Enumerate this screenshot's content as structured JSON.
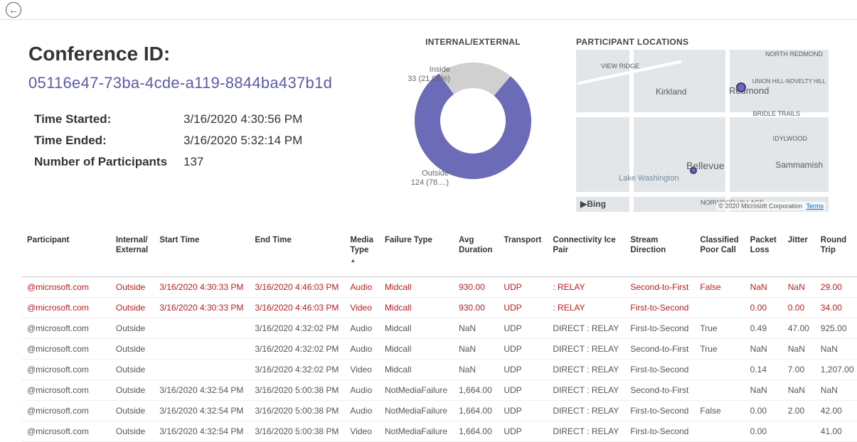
{
  "header": {
    "conference_label": "Conference ID:",
    "conference_id": "05116e47-73ba-4cde-a119-8844ba437b1d",
    "fields": {
      "time_started_label": "Time Started:",
      "time_started_value": "3/16/2020 4:30:56 PM",
      "time_ended_label": "Time Ended:",
      "time_ended_value": "3/16/2020 5:32:14 PM",
      "participants_label": "Number of Participants",
      "participants_value": "137"
    }
  },
  "donut": {
    "title": "INTERNAL/EXTERNAL",
    "inside_label": "Inside",
    "inside_count": "33 (21.02%)",
    "outside_label": "Outside",
    "outside_count": "124 (78....)"
  },
  "map": {
    "title": "PARTICIPANT LOCATIONS",
    "bing": "Bing",
    "attribution": "© 2020 Microsoft Corporation",
    "terms": "Terms",
    "cities": {
      "kirkland": "Kirkland",
      "redmond": "Redmond",
      "bellevue": "Bellevue",
      "sammamish": "Sammamish",
      "view_ridge": "VIEW RIDGE",
      "north_redmond": "NORTH REDMOND",
      "union_hill": "UNION HILL-NOVELTY HILL",
      "bridle_trails": "BRIDLE TRAILS",
      "idylwood": "IDYLWOOD",
      "norwood": "NORWOOD VILLAGE",
      "lake_wa": "Lake Washington"
    }
  },
  "chart_data": {
    "type": "pie",
    "title": "INTERNAL/EXTERNAL",
    "series": [
      {
        "name": "Inside",
        "value": 33,
        "percent": 21.02,
        "color": "#d0d0d0"
      },
      {
        "name": "Outside",
        "value": 124,
        "percent": 78.98,
        "color": "#6b6bb8"
      }
    ]
  },
  "table": {
    "columns": [
      {
        "key": "Participant",
        "label": "Participant"
      },
      {
        "key": "InternalExternal",
        "label": "Internal/ External"
      },
      {
        "key": "StartTime",
        "label": "Start Time"
      },
      {
        "key": "EndTime",
        "label": "End Time"
      },
      {
        "key": "MediaType",
        "label": "Media Type",
        "sort": true
      },
      {
        "key": "FailureType",
        "label": "Failure Type"
      },
      {
        "key": "AvgDuration",
        "label": "Avg Duration"
      },
      {
        "key": "Transport",
        "label": "Transport"
      },
      {
        "key": "ConnectivityIcePair",
        "label": "Connectivity Ice Pair"
      },
      {
        "key": "StreamDirection",
        "label": "Stream Direction"
      },
      {
        "key": "ClassifiedPoorCall",
        "label": "Classified Poor Call"
      },
      {
        "key": "PacketLoss",
        "label": "Packet Loss"
      },
      {
        "key": "Jitter",
        "label": "Jitter"
      },
      {
        "key": "RoundTrip",
        "label": "Round Trip"
      }
    ],
    "rows": [
      {
        "poor": true,
        "Participant": "@microsoft.com",
        "InternalExternal": "Outside",
        "StartTime": "3/16/2020 4:30:33 PM",
        "EndTime": "3/16/2020 4:46:03 PM",
        "MediaType": "Audio",
        "FailureType": "Midcall",
        "AvgDuration": "930.00",
        "Transport": "UDP",
        "ConnectivityIcePair": ": RELAY",
        "StreamDirection": "Second-to-First",
        "ClassifiedPoorCall": "False",
        "PacketLoss": "NaN",
        "Jitter": "NaN",
        "RoundTrip": "29.00"
      },
      {
        "poor": true,
        "Participant": "@microsoft.com",
        "InternalExternal": "Outside",
        "StartTime": "3/16/2020 4:30:33 PM",
        "EndTime": "3/16/2020 4:46:03 PM",
        "MediaType": "Video",
        "FailureType": "Midcall",
        "AvgDuration": "930.00",
        "Transport": "UDP",
        "ConnectivityIcePair": ": RELAY",
        "StreamDirection": "First-to-Second",
        "ClassifiedPoorCall": "",
        "PacketLoss": "0.00",
        "Jitter": "0.00",
        "RoundTrip": "34.00"
      },
      {
        "poor": false,
        "Participant": "@microsoft.com",
        "InternalExternal": "Outside",
        "StartTime": "",
        "EndTime": "3/16/2020 4:32:02 PM",
        "MediaType": "Audio",
        "FailureType": "Midcall",
        "AvgDuration": "NaN",
        "Transport": "UDP",
        "ConnectivityIcePair": "DIRECT : RELAY",
        "StreamDirection": "First-to-Second",
        "ClassifiedPoorCall": "True",
        "PacketLoss": "0.49",
        "Jitter": "47.00",
        "RoundTrip": "925.00"
      },
      {
        "poor": false,
        "Participant": "@microsoft.com",
        "InternalExternal": "Outside",
        "StartTime": "",
        "EndTime": "3/16/2020 4:32:02 PM",
        "MediaType": "Audio",
        "FailureType": "Midcall",
        "AvgDuration": "NaN",
        "Transport": "UDP",
        "ConnectivityIcePair": "DIRECT : RELAY",
        "StreamDirection": "Second-to-First",
        "ClassifiedPoorCall": "True",
        "PacketLoss": "NaN",
        "Jitter": "NaN",
        "RoundTrip": "NaN"
      },
      {
        "poor": false,
        "Participant": "@microsoft.com",
        "InternalExternal": "Outside",
        "StartTime": "",
        "EndTime": "3/16/2020 4:32:02 PM",
        "MediaType": "Video",
        "FailureType": "Midcall",
        "AvgDuration": "NaN",
        "Transport": "UDP",
        "ConnectivityIcePair": "DIRECT : RELAY",
        "StreamDirection": "First-to-Second",
        "ClassifiedPoorCall": "",
        "PacketLoss": "0.14",
        "Jitter": "7.00",
        "RoundTrip": "1,207.00"
      },
      {
        "poor": false,
        "Participant": "@microsoft.com",
        "InternalExternal": "Outside",
        "StartTime": "3/16/2020 4:32:54 PM",
        "EndTime": "3/16/2020 5:00:38 PM",
        "MediaType": "Audio",
        "FailureType": "NotMediaFailure",
        "AvgDuration": "1,664.00",
        "Transport": "UDP",
        "ConnectivityIcePair": "DIRECT : RELAY",
        "StreamDirection": "Second-to-First",
        "ClassifiedPoorCall": "",
        "PacketLoss": "NaN",
        "Jitter": "NaN",
        "RoundTrip": "NaN"
      },
      {
        "poor": false,
        "Participant": "@microsoft.com",
        "InternalExternal": "Outside",
        "StartTime": "3/16/2020 4:32:54 PM",
        "EndTime": "3/16/2020 5:00:38 PM",
        "MediaType": "Audio",
        "FailureType": "NotMediaFailure",
        "AvgDuration": "1,664.00",
        "Transport": "UDP",
        "ConnectivityIcePair": "DIRECT : RELAY",
        "StreamDirection": "First-to-Second",
        "ClassifiedPoorCall": "False",
        "PacketLoss": "0.00",
        "Jitter": "2.00",
        "RoundTrip": "42.00"
      },
      {
        "poor": false,
        "Participant": "@microsoft.com",
        "InternalExternal": "Outside",
        "StartTime": "3/16/2020 4:32:54 PM",
        "EndTime": "3/16/2020 5:00:38 PM",
        "MediaType": "Video",
        "FailureType": "NotMediaFailure",
        "AvgDuration": "1,664.00",
        "Transport": "UDP",
        "ConnectivityIcePair": "DIRECT : RELAY",
        "StreamDirection": "First-to-Second",
        "ClassifiedPoorCall": "",
        "PacketLoss": "0.00",
        "Jitter": "",
        "RoundTrip": "41.00"
      }
    ]
  }
}
